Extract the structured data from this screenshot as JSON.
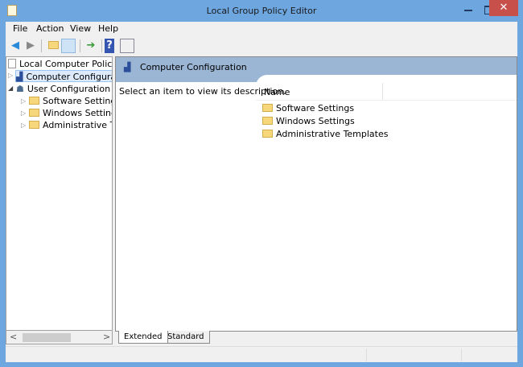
{
  "window": {
    "title": "Local Group Policy Editor",
    "close": "✕"
  },
  "menu": [
    "File",
    "Action",
    "View",
    "Help"
  ],
  "toolbar": {
    "back": "back-icon",
    "forward": "forward-icon",
    "up": "up-folder-icon",
    "show_hide_tree": "show-hide-tree-icon",
    "export": "export-list-icon",
    "help": "help-icon",
    "help_glyph": "?",
    "properties": "properties-icon"
  },
  "tree": {
    "root": "Local Computer Policy",
    "items": [
      {
        "label": "Computer Configurati",
        "selected": true
      },
      {
        "label": "User Configuration"
      },
      {
        "label": "Software Settings"
      },
      {
        "label": "Windows Settings"
      },
      {
        "label": "Administrative Ter"
      }
    ],
    "scroll_left": "<",
    "scroll_right": ">"
  },
  "main": {
    "header": "Computer Configuration",
    "description": "Select an item to view its description.",
    "column_name": "Name",
    "items": [
      "Software Settings",
      "Windows Settings",
      "Administrative Templates"
    ]
  },
  "tabs": [
    "Extended",
    "Standard"
  ]
}
